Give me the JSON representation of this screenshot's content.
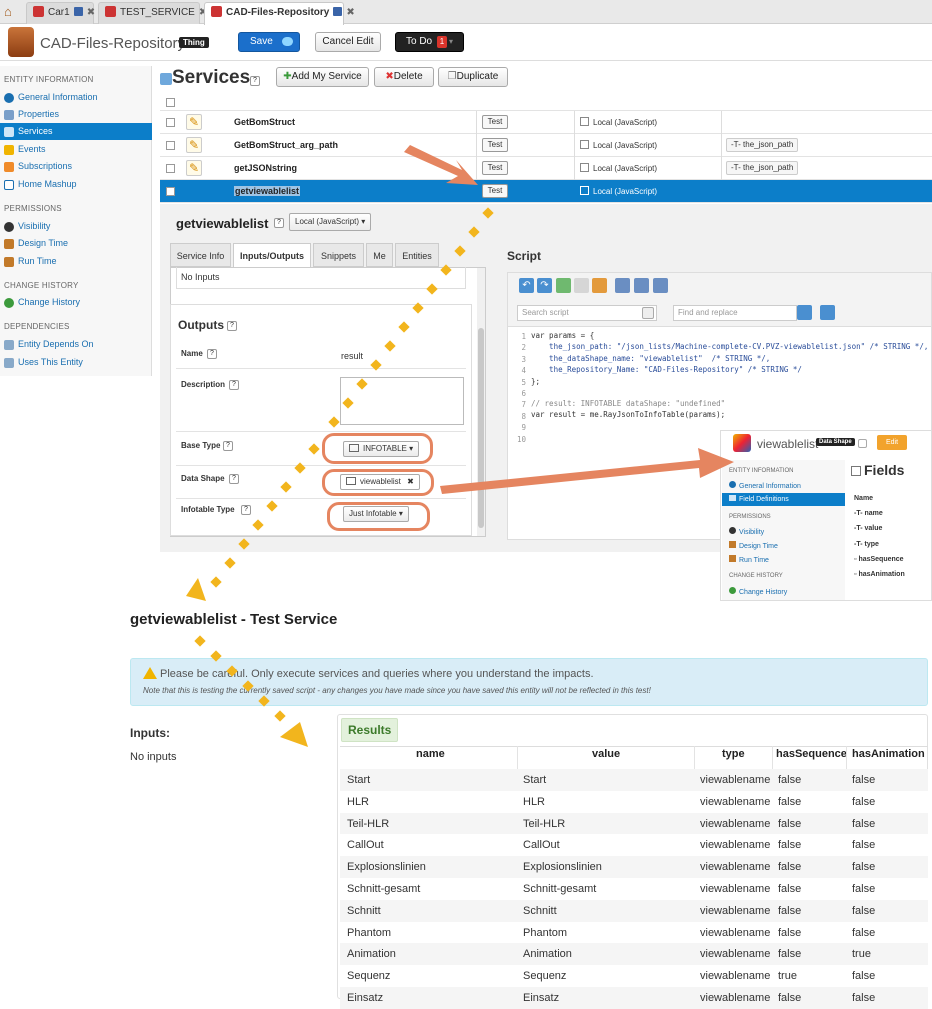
{
  "tabs": [
    {
      "label": "Car1"
    },
    {
      "label": "TEST_SERVICE"
    },
    {
      "label": "CAD-Files-Repository"
    }
  ],
  "header": {
    "title": "CAD-Files-Repository",
    "badge": "Thing",
    "save": "Save",
    "cancel": "Cancel Edit",
    "todo": "To Do",
    "todo_count": "1"
  },
  "sidebar": {
    "entity_info": "ENTITY INFORMATION",
    "general": "General Information",
    "properties": "Properties",
    "services": "Services",
    "events": "Events",
    "subscriptions": "Subscriptions",
    "home_mashup": "Home Mashup",
    "permissions": "PERMISSIONS",
    "visibility": "Visibility",
    "design_time": "Design Time",
    "run_time": "Run Time",
    "change_history": "CHANGE HISTORY",
    "change_history_item": "Change History",
    "dependencies": "DEPENDENCIES",
    "depends_on": "Entity Depends On",
    "uses": "Uses This Entity"
  },
  "services": {
    "title": "Services",
    "add": "Add My Service",
    "delete": "Delete",
    "duplicate": "Duplicate",
    "rows": [
      {
        "name": "GetBomStruct",
        "test": "Test",
        "type": "Local (JavaScript)",
        "param": ""
      },
      {
        "name": "GetBomStruct_arg_path",
        "test": "Test",
        "type": "Local (JavaScript)",
        "param": "the_json_path"
      },
      {
        "name": "getJSONstring",
        "test": "Test",
        "type": "Local (JavaScript)",
        "param": "the_json_path"
      },
      {
        "name": "getviewablelist",
        "test": "Test",
        "type": "Local (JavaScript)",
        "param": ""
      }
    ]
  },
  "editor": {
    "name": "getviewablelist",
    "type": "Local (JavaScript)",
    "tabs": [
      "Service Info",
      "Inputs/Outputs",
      "Snippets",
      "Me",
      "Entities"
    ],
    "no_inputs": "No Inputs",
    "outputs": "Outputs",
    "name_label": "Name",
    "name_value": "result",
    "description": "Description",
    "base_type": "Base Type",
    "base_type_value": "INFOTABLE",
    "data_shape": "Data Shape",
    "data_shape_value": "viewablelist",
    "infotable_type": "Infotable Type",
    "infotable_type_value": "Just Infotable",
    "script_title": "Script",
    "search_placeholder": "Search script",
    "replace_placeholder": "Find and replace",
    "code": [
      "var params = {",
      "    the_json_path: \"/json_lists/Machine-complete-CV.PVZ-viewablelist.json\" /* STRING */,",
      "    the_dataShape_name: \"viewablelist\"  /* STRING */,",
      "    the_Repository_Name: \"CAD-Files-Repository\" /* STRING */",
      "};",
      "",
      "// result: INFOTABLE dataShape: \"undefined\"",
      "var result = me.RayJsonToInfoTable(params);",
      "",
      ""
    ]
  },
  "datashape_panel": {
    "title": "viewablelist",
    "badge": "Data Shape",
    "edit": "Edit",
    "entity_info": "ENTITY INFORMATION",
    "general": "General Information",
    "field_defs": "Field Definitions",
    "permissions": "PERMISSIONS",
    "visibility": "Visibility",
    "design_time": "Design Time",
    "run_time": "Run Time",
    "change_history": "CHANGE HISTORY",
    "change_history_item": "Change History",
    "fields_title": "Fields",
    "name_col": "Name",
    "fields": [
      "name",
      "value",
      "type",
      "hasSequence",
      "hasAnimation"
    ]
  },
  "test_service": {
    "title": "getviewablelist - Test Service",
    "warning": "Please be careful. Only execute services and queries where you understand the impacts.",
    "note": "Note that this is testing the currently saved script - any changes you have made since you have saved this entity will not be reflected in this test!",
    "inputs": "Inputs:",
    "no_inputs": "No inputs",
    "results": "Results",
    "columns": [
      "name",
      "value",
      "type",
      "hasSequence",
      "hasAnimation"
    ],
    "rows": [
      [
        "Start",
        "Start",
        "viewablename",
        "false",
        "false"
      ],
      [
        "HLR",
        "HLR",
        "viewablename",
        "false",
        "false"
      ],
      [
        "Teil-HLR",
        "Teil-HLR",
        "viewablename",
        "false",
        "false"
      ],
      [
        "CallOut",
        "CallOut",
        "viewablename",
        "false",
        "false"
      ],
      [
        "Explosionslinien",
        "Explosionslinien",
        "viewablename",
        "false",
        "false"
      ],
      [
        "Schnitt-gesamt",
        "Schnitt-gesamt",
        "viewablename",
        "false",
        "false"
      ],
      [
        "Schnitt",
        "Schnitt",
        "viewablename",
        "false",
        "false"
      ],
      [
        "Phantom",
        "Phantom",
        "viewablename",
        "false",
        "false"
      ],
      [
        "Animation",
        "Animation",
        "viewablename",
        "false",
        "true"
      ],
      [
        "Sequenz",
        "Sequenz",
        "viewablename",
        "true",
        "false"
      ],
      [
        "Einsatz",
        "Einsatz",
        "viewablename",
        "false",
        "false"
      ]
    ]
  },
  "colors": {
    "accent": "#0c7ec9",
    "annotation": "#e58560",
    "arrow_gold": "#f2b51d"
  }
}
